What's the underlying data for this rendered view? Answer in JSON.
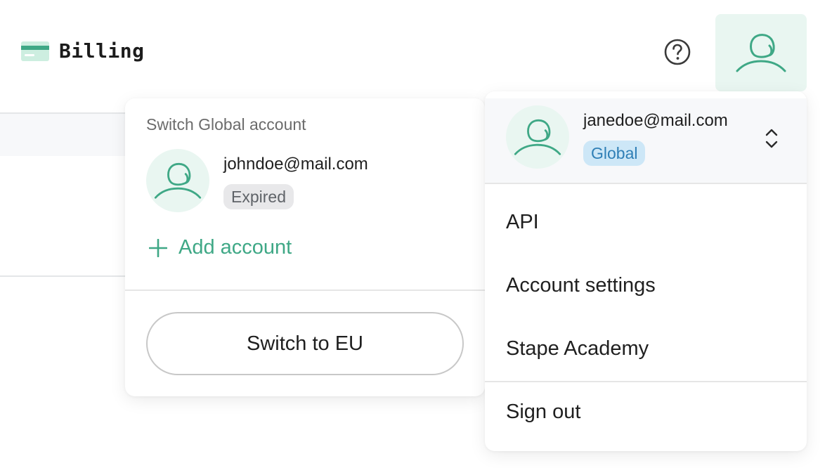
{
  "header": {
    "title": "Billing",
    "title_icon": "credit-card-icon",
    "help_icon": "help-circle-icon",
    "avatar_icon": "user-icon"
  },
  "switch_panel": {
    "heading": "Switch Global account",
    "account": {
      "email": "johndoe@mail.com",
      "status": "Expired"
    },
    "add_account_label": "Add account",
    "switch_region_button": "Switch to EU"
  },
  "profile_menu": {
    "current_account": {
      "email": "janedoe@mail.com",
      "region_badge": "Global"
    },
    "items": [
      {
        "label": "API"
      },
      {
        "label": "Account settings"
      },
      {
        "label": "Stape Academy"
      }
    ],
    "sign_out_label": "Sign out"
  },
  "colors": {
    "accent_green": "#3fa886",
    "avatar_bg": "#e9f6f1",
    "badge_global_bg": "#cde7f7",
    "badge_global_text": "#2f7fb6",
    "badge_expired_bg": "#e8e8ea"
  }
}
